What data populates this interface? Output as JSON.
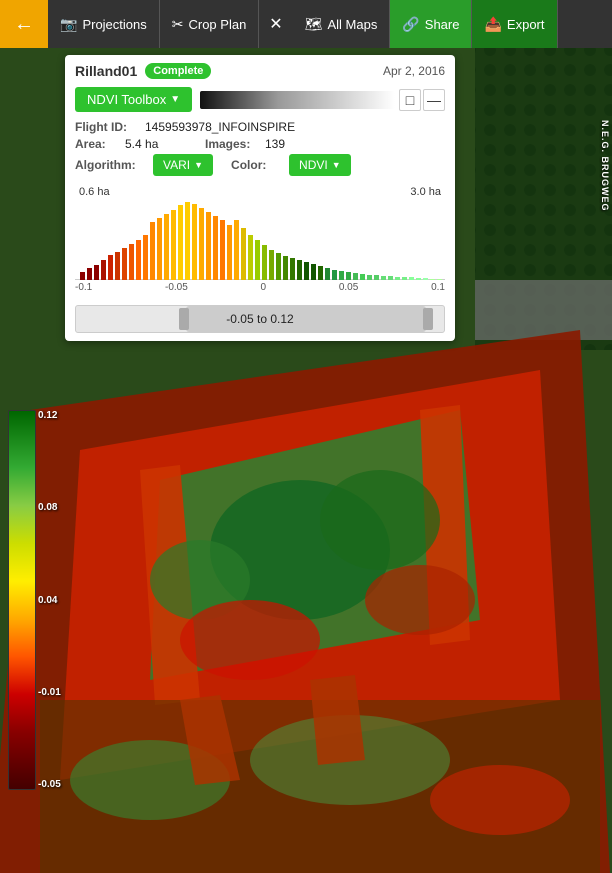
{
  "navbar": {
    "back_label": "←",
    "items": [
      {
        "id": "projections",
        "icon": "📷",
        "label": "Projections"
      },
      {
        "id": "crop-plan",
        "icon": "✂",
        "label": "Crop Plan"
      },
      {
        "id": "separator",
        "icon": "✕",
        "label": ""
      },
      {
        "id": "all-maps",
        "icon": "🗺",
        "label": "All Maps"
      },
      {
        "id": "share",
        "icon": "🔗",
        "label": "Share"
      },
      {
        "id": "export",
        "icon": "📤",
        "label": "Export"
      }
    ]
  },
  "panel": {
    "title": "Rilland01",
    "status": "Complete",
    "date": "Apr 2, 2016",
    "toolbox_label": "NDVI Toolbox",
    "flight_id_label": "Flight ID:",
    "flight_id_value": "1459593978_INFOINSPIRE",
    "area_label": "Area:",
    "area_value": "5.4 ha",
    "images_label": "Images:",
    "images_value": "139",
    "algorithm_label": "Algorithm:",
    "algorithm_value": "VARI",
    "color_label": "Color:",
    "color_value": "NDVI",
    "histogram": {
      "left_ha": "0.6 ha",
      "right_ha": "3.0 ha",
      "x_labels": [
        "-0.1",
        "-0.05",
        "0",
        "0.05",
        "0.1"
      ]
    },
    "range_label": "-0.05 to 0.12"
  },
  "legend": {
    "labels": [
      "0.12",
      "0.08",
      "0.04",
      "-0.01",
      "-0.05"
    ]
  },
  "road_label": "N.E.G. BRUGWEG"
}
